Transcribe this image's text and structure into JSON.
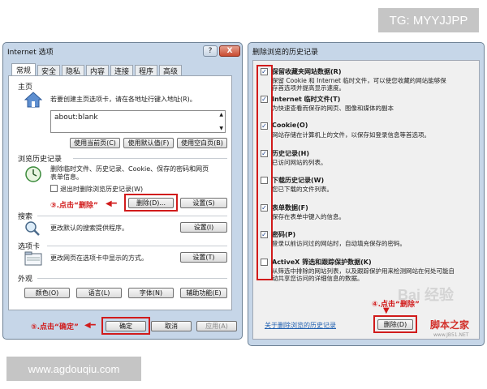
{
  "watermark_top": "TG: MYYJJPP",
  "watermark_bottom": "www.agdouqiu.com",
  "internet_options": {
    "title": "Internet 选项",
    "help_btn": "?",
    "close_btn": "X",
    "tabs": [
      "常规",
      "安全",
      "隐私",
      "内容",
      "连接",
      "程序",
      "高级"
    ],
    "homepage": {
      "section": "主页",
      "desc": "若要创建主页选项卡，请在各地址行键入地址(R)。",
      "url_value": "about:blank",
      "btn_current": "使用当前页(C)",
      "btn_default": "使用默认值(F)",
      "btn_blank": "使用空白页(B)"
    },
    "history": {
      "section": "浏览历史记录",
      "desc_line1": "删除临时文件、历史记录、Cookie、保存的密码和网页",
      "desc_line2": "表单信息。",
      "checkbox_label": "退出时删除浏览历史记录(W)",
      "annotation": "③.点击“删除”",
      "btn_delete": "删除(D)...",
      "btn_settings": "设置(S)"
    },
    "search": {
      "section": "搜索",
      "desc": "更改默认的搜索提供程序。",
      "btn_settings": "设置(I)"
    },
    "tabs_section": {
      "section": "选项卡",
      "desc": "更改网页在选项卡中显示的方式。",
      "btn_settings": "设置(T)"
    },
    "appearance": {
      "section": "外观",
      "btn_colors": "颜色(O)",
      "btn_languages": "语言(L)",
      "btn_fonts": "字体(N)",
      "btn_accessibility": "辅助功能(E)"
    },
    "footer": {
      "annotation": "⑤.点击“确定”",
      "btn_ok": "确定",
      "btn_cancel": "取消",
      "btn_apply": "应用(A)"
    }
  },
  "delete_history": {
    "title": "删除浏览的历史记录",
    "items": [
      {
        "checked": true,
        "label": "保留收藏夹网站数据(R)",
        "desc1": "保留 Cookie 和 Internet 临时文件，可以使您收藏的网站能够保",
        "desc2": "存首选项并提高显示速度。"
      },
      {
        "checked": true,
        "label": "Internet 临时文件(T)",
        "desc1": "为快速查看而保存的网页、图像和媒体的副本",
        "desc2": ""
      },
      {
        "checked": true,
        "label": "Cookie(O)",
        "desc1": "网站存储在计算机上的文件，以保存如登录信息等首选项。",
        "desc2": ""
      },
      {
        "checked": true,
        "label": "历史记录(H)",
        "desc1": "已访问网站的列表。",
        "desc2": ""
      },
      {
        "checked": false,
        "label": "下载历史记录(W)",
        "desc1": "您已下载的文件列表。",
        "desc2": ""
      },
      {
        "checked": true,
        "label": "表单数据(F)",
        "desc1": "保存在表单中键入的信息。",
        "desc2": ""
      },
      {
        "checked": true,
        "label": "密码(P)",
        "desc1": "登录以前访问过的网站时，自动填充保存的密码。",
        "desc2": ""
      },
      {
        "checked": false,
        "label": "ActiveX 筛选和跟踪保护数据(K)",
        "desc1": "从筛选中排除的网站列表，以及跟踪保护用来检测网站在何处可能自",
        "desc2": "动共享您访问的详细信息的数据。"
      }
    ],
    "annotation": "④.点击“删除”",
    "link": "关于删除浏览的历史记录",
    "btn_delete": "删除(D)",
    "site_logo": "脚本之家",
    "site_url": "www.JB51.NET",
    "baidu_mark": "Bai 经验"
  }
}
